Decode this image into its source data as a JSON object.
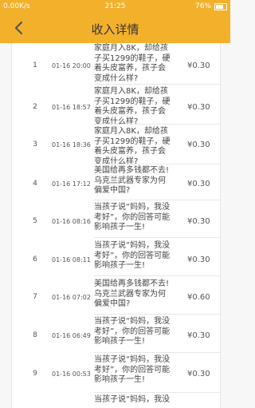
{
  "status_bar": {
    "network_speed": "0.00K/s",
    "time": "21:25",
    "battery": "76%"
  },
  "header": {
    "title": "收入详情",
    "back_icon": "chevron-left-icon"
  },
  "rows": [
    {
      "index": "1",
      "time": "01-16 20:00",
      "title": "家庭月入8K，却给孩子买1299的鞋子，硬着头皮富养，孩子会变成什么样?",
      "amount": "¥0.30"
    },
    {
      "index": "2",
      "time": "01-16 18:57",
      "title": "家庭月入8K，却给孩子买1299的鞋子，硬着头皮富养，孩子会变成什么样?",
      "amount": "¥0.30"
    },
    {
      "index": "3",
      "time": "01-16 18:36",
      "title": "家庭月入8K，却给孩子买1299的鞋子，硬着头皮富养，孩子会变成什么样?",
      "amount": "¥0.30"
    },
    {
      "index": "4",
      "time": "01-16 17:12",
      "title": "美国给再多钱都不去!乌克兰武器专家为何偏爱中国?",
      "amount": "¥0.30"
    },
    {
      "index": "5",
      "time": "01-16 08:16",
      "title": "当孩子说“妈妈，我没考好”，你的回答可能影响孩子一生!",
      "amount": "¥0.30"
    },
    {
      "index": "6",
      "time": "01-16 08:11",
      "title": "当孩子说“妈妈，我没考好”，你的回答可能影响孩子一生!",
      "amount": "¥0.30"
    },
    {
      "index": "7",
      "time": "01-16 07:02",
      "title": "美国给再多钱都不去!乌克兰武器专家为何偏爱中国?",
      "amount": "¥0.60"
    },
    {
      "index": "8",
      "time": "01-16 06:49",
      "title": "当孩子说“妈妈，我没考好”，你的回答可能影响孩子一生!",
      "amount": "¥0.30"
    },
    {
      "index": "9",
      "time": "01-16 00:53",
      "title": "当孩子说“妈妈，我没考好”，你的回答可能影响孩子一生!",
      "amount": "¥0.30"
    },
    {
      "index": "",
      "time": "",
      "title": "当孩子说“妈妈，我没",
      "amount": ""
    }
  ]
}
